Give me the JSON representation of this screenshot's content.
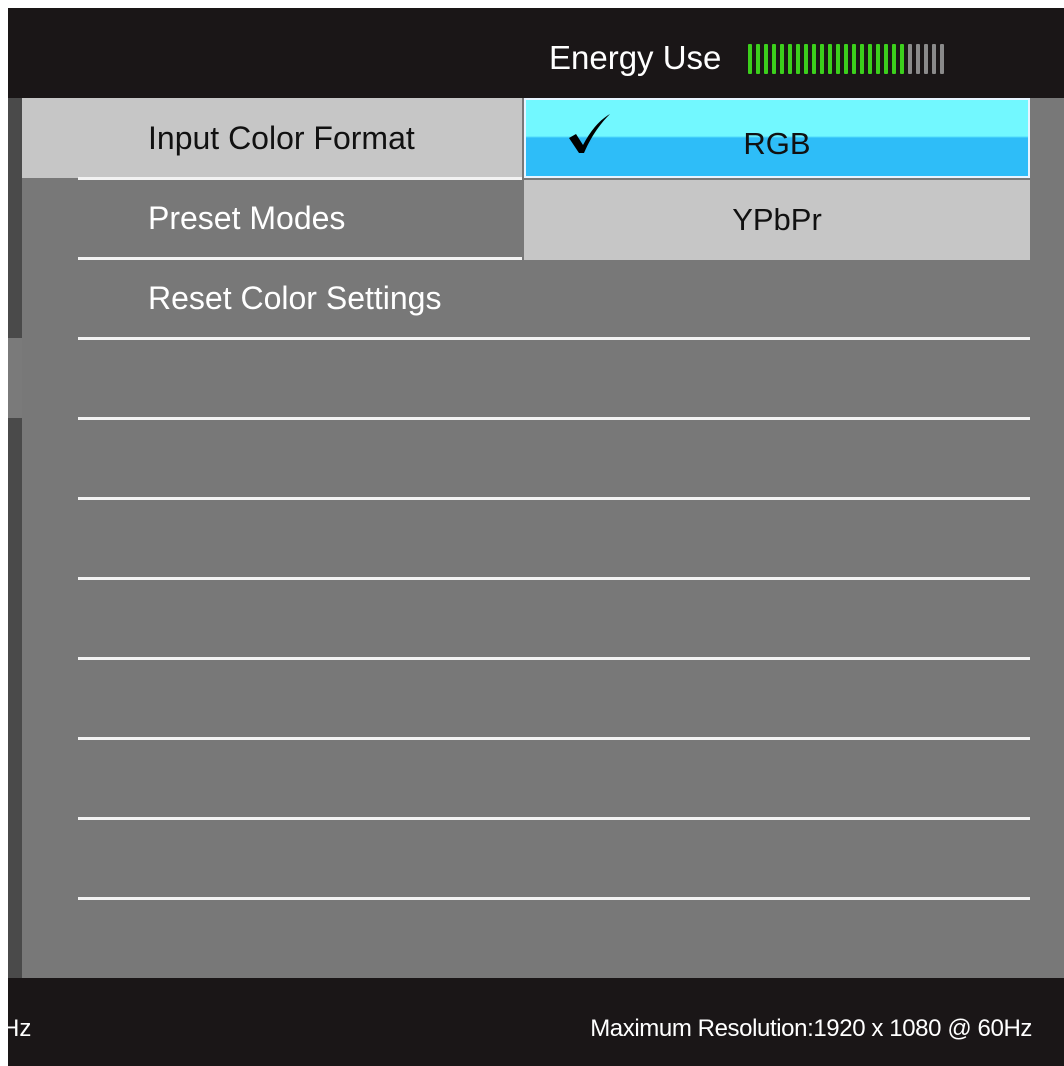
{
  "header": {
    "energy_label": "Energy Use",
    "energy_level": "20 of 25 segments lit",
    "energy_segments_total": 25,
    "energy_segments_on": 20,
    "colors": {
      "meter_on": "#3ccf1c",
      "meter_off": "#8a8a8a"
    }
  },
  "menu": {
    "items": [
      {
        "label": "Input Color Format",
        "selected": true
      },
      {
        "label": "Preset Modes",
        "selected": false
      },
      {
        "label": "Reset Color Settings",
        "selected": false
      }
    ]
  },
  "submenu": {
    "options": [
      {
        "label": "RGB",
        "checked": true,
        "icon": "checkmark-icon"
      },
      {
        "label": "YPbPr",
        "checked": false
      }
    ],
    "colors": {
      "highlight_top": "#72f8ff",
      "highlight_bottom": "#2ebdf8"
    }
  },
  "footer": {
    "left_text": "Hz",
    "right_text": "Maximum Resolution:1920 x 1080 @ 60Hz"
  }
}
